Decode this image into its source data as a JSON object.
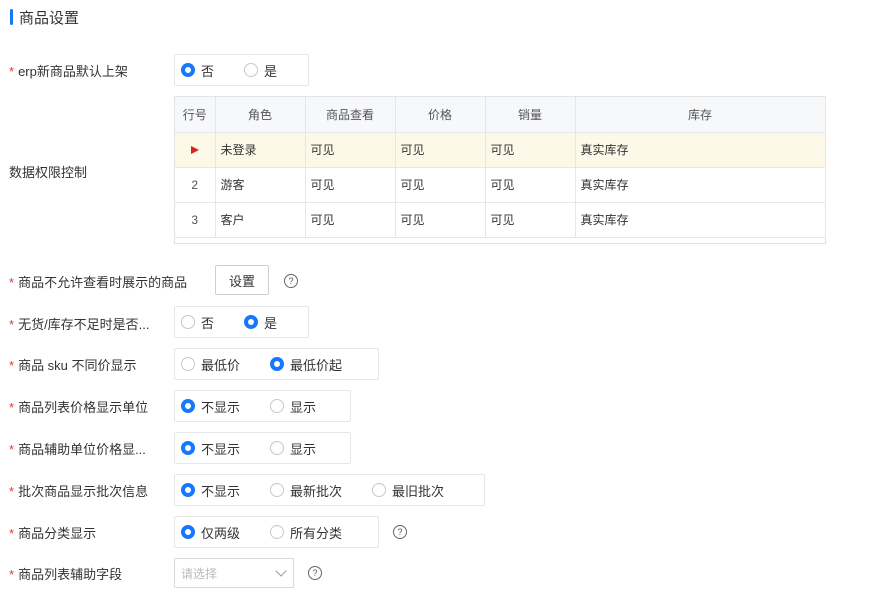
{
  "section": {
    "title": "商品设置"
  },
  "fields": {
    "erp_default_listing": {
      "label": "erp新商品默认上架",
      "required": true,
      "options": [
        "否",
        "是"
      ],
      "selected": "否"
    },
    "data_permission": {
      "label": "数据权限控制",
      "required": false
    },
    "hidden_goods": {
      "label": "商品不允许查看时展示的商品",
      "required": true,
      "button": "设置",
      "help": "?"
    },
    "out_of_stock": {
      "label": "无货/库存不足时是否...",
      "required": true,
      "options": [
        "否",
        "是"
      ],
      "selected": "是"
    },
    "sku_price_display": {
      "label": "商品 sku 不同价显示",
      "required": true,
      "options": [
        "最低价",
        "最低价起"
      ],
      "selected": "最低价起"
    },
    "list_price_unit": {
      "label": "商品列表价格显示单位",
      "required": true,
      "options": [
        "不显示",
        "显示"
      ],
      "selected": "不显示"
    },
    "aux_unit_price": {
      "label": "商品辅助单位价格显...",
      "required": true,
      "options": [
        "不显示",
        "显示"
      ],
      "selected": "不显示"
    },
    "batch_info": {
      "label": "批次商品显示批次信息",
      "required": true,
      "options": [
        "不显示",
        "最新批次",
        "最旧批次"
      ],
      "selected": "不显示"
    },
    "category_display": {
      "label": "商品分类显示",
      "required": true,
      "options": [
        "仅两级",
        "所有分类"
      ],
      "selected": "仅两级",
      "help": "?"
    },
    "list_aux_fields": {
      "label": "商品列表辅助字段",
      "required": true,
      "placeholder": "请选择",
      "help": "?"
    }
  },
  "permission_table": {
    "columns": [
      "行号",
      "角色",
      "商品查看",
      "价格",
      "销量",
      "库存"
    ],
    "rows": [
      {
        "no": "",
        "role": "未登录",
        "view": "可见",
        "price": "可见",
        "sales": "可见",
        "stock": "真实库存",
        "current": true
      },
      {
        "no": "2",
        "role": "游客",
        "view": "可见",
        "price": "可见",
        "sales": "可见",
        "stock": "真实库存"
      },
      {
        "no": "3",
        "role": "客户",
        "view": "可见",
        "price": "可见",
        "sales": "可见",
        "stock": "真实库存"
      }
    ]
  },
  "colors": {
    "accent": "#1677ff",
    "required": "#e33333",
    "selected_row": "#fdf9e9",
    "row_marker": "#d92121"
  }
}
